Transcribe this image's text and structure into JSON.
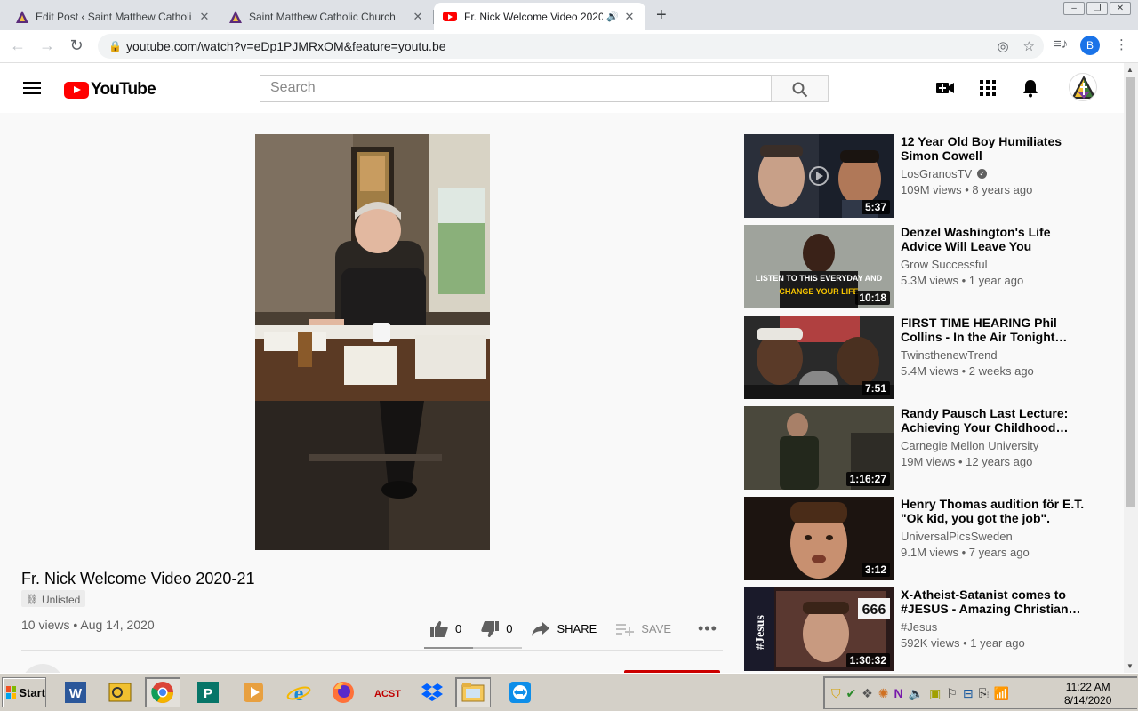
{
  "browser": {
    "tabs": [
      {
        "title": "Edit Post ‹ Saint Matthew Catholi",
        "state": "inactive"
      },
      {
        "title": "Saint Matthew Catholic Church",
        "state": "inactive"
      },
      {
        "title": "Fr. Nick Welcome Video 2020",
        "state": "active"
      }
    ],
    "url": "youtube.com/watch?v=eDp1PJMRxOM&feature=youtu.be",
    "profile_initial": "B",
    "close_glyph": "✕",
    "new_tab_glyph": "+"
  },
  "youtube": {
    "logo_text": "YouTube",
    "search_placeholder": "Search",
    "video": {
      "title": "Fr. Nick Welcome Video 2020-21",
      "badge": "Unlisted",
      "meta": "10 views • Aug 14, 2020",
      "likes": "0",
      "dislikes": "0",
      "share_label": "SHARE",
      "save_label": "SAVE",
      "like_ratio": 0.5
    },
    "recommendations": [
      {
        "title": "12 Year Old Boy Humiliates Simon Cowell",
        "channel": "LosGranosTV",
        "verified": true,
        "meta": "109M views • 8 years ago",
        "duration": "5:37"
      },
      {
        "title": "Denzel Washington's Life Advice Will Leave You SPEECHLESS…",
        "channel": "Grow Successful",
        "verified": false,
        "meta": "5.3M views • 1 year ago",
        "duration": "10:18",
        "thumb_text_1": "LISTEN TO THIS EVERYDAY AND",
        "thumb_text_2": "CHANGE YOUR LIFE"
      },
      {
        "title": "FIRST TIME HEARING Phil Collins - In the Air Tonight…",
        "channel": "TwinsthenewTrend",
        "verified": false,
        "meta": "5.4M views • 2 weeks ago",
        "duration": "7:51"
      },
      {
        "title": "Randy Pausch Last Lecture: Achieving Your Childhood…",
        "channel": "Carnegie Mellon University",
        "verified": false,
        "meta": "19M views • 12 years ago",
        "duration": "1:16:27"
      },
      {
        "title": "Henry Thomas audition för E.T. \"Ok kid, you got the job\".",
        "channel": "UniversalPicsSweden",
        "verified": false,
        "meta": "9.1M views • 7 years ago",
        "duration": "3:12"
      },
      {
        "title": "X-Atheist-Satanist comes to #JESUS - Amazing Christian…",
        "channel": "#Jesus",
        "verified": false,
        "meta": "592K views • 1 year ago",
        "duration": "1:30:32",
        "thumb_text_1": "#Jesus",
        "thumb_text_2": "666"
      }
    ]
  },
  "taskbar": {
    "start_label": "Start",
    "acst_label": "ACST",
    "time": "11:22 AM",
    "date": "8/14/2020"
  },
  "colors": {
    "youtube_red": "#ff0000",
    "chrome_tabbar": "#dee1e6",
    "taskbar": "#d4d0c8"
  }
}
